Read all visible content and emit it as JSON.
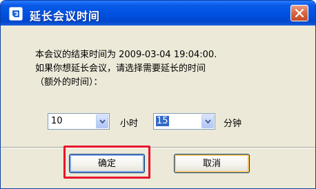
{
  "window": {
    "title": "延长会议时间"
  },
  "message": {
    "line1": "本会议的结束时间为 2009-03-04 19:04:00.",
    "line2": "如果你想延长会议，请选择需要延长的时间",
    "line3": "（额外的时间）："
  },
  "hours": {
    "value": "10",
    "unit": "小时"
  },
  "minutes": {
    "value": "15",
    "unit": "分钟"
  },
  "buttons": {
    "ok": "确定",
    "cancel": "取消"
  },
  "icons": {
    "app": "app-logo-icon",
    "close": "close-icon",
    "dropdown": "chevron-down-icon"
  },
  "colors": {
    "titlebar": "#0050e0",
    "close": "#d86a46",
    "highlight": "#e8102a",
    "selection": "#316ac5"
  }
}
